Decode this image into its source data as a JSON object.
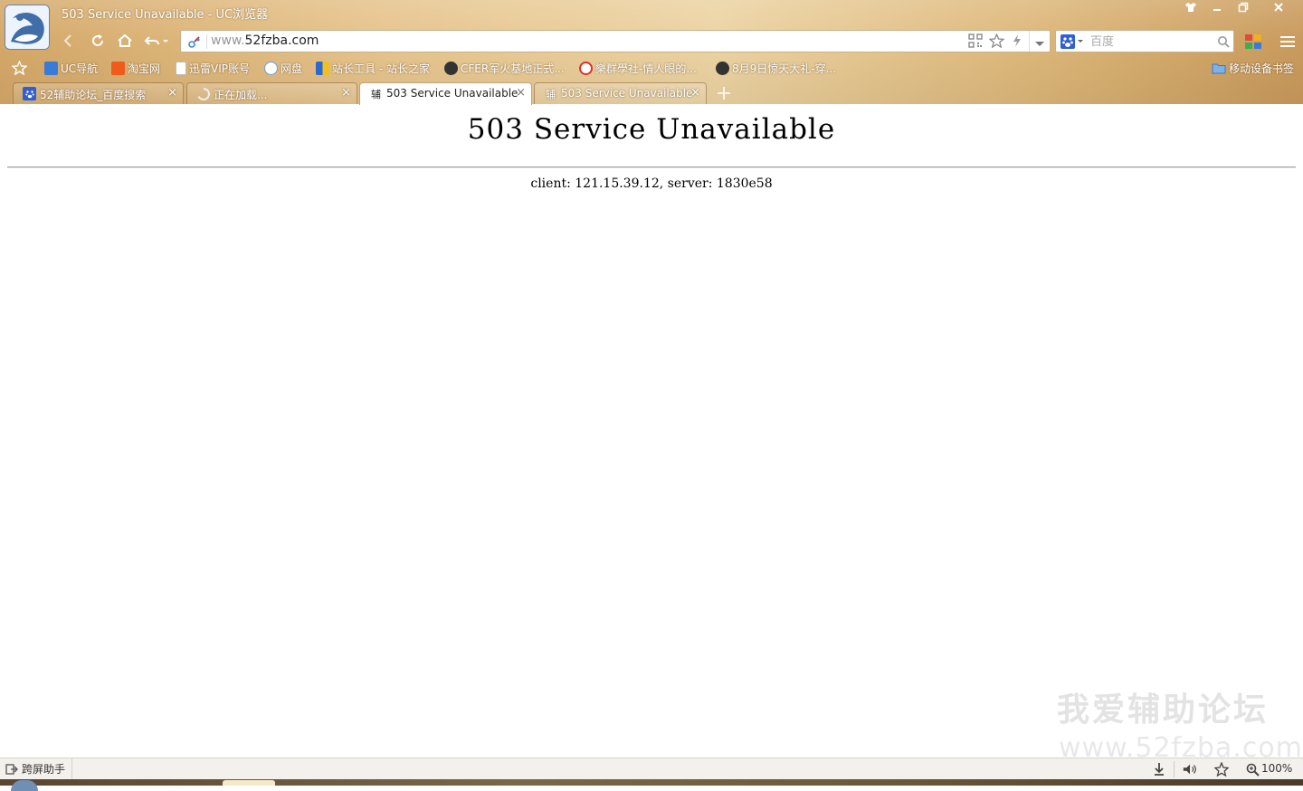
{
  "window": {
    "title": "503 Service Unavailable - UC浏览器"
  },
  "toolbar": {
    "address_prefix": "www.",
    "address_domain": "52fzba.com",
    "search_placeholder": "百度"
  },
  "bookmarks": {
    "items": [
      {
        "label": "UC导航"
      },
      {
        "label": "淘宝网"
      },
      {
        "label": "迅雷VIP账号"
      },
      {
        "label": "网盘"
      },
      {
        "label": "站长工具 - 站长之家"
      },
      {
        "label": "CFER军火基地正式..."
      },
      {
        "label": "樂群學社-情人眼的..."
      },
      {
        "label": "8月9日惊天大礼-穿..."
      }
    ],
    "mobile_folder": "移动设备书签"
  },
  "tabs": [
    {
      "label": "52辅助论坛_百度搜索",
      "icon": "辅"
    },
    {
      "label": "正在加载...",
      "icon": ""
    },
    {
      "label": "503 Service Unavailable",
      "icon": "辅",
      "active": true
    },
    {
      "label": "503 Service Unavailable",
      "icon": "辅"
    }
  ],
  "content": {
    "heading": "503 Service Unavailable",
    "detail": "client: 121.15.39.12, server: 1830e58",
    "watermark_cn": "我爱辅助论坛",
    "watermark_url": "www.52fzba.com"
  },
  "statusbar": {
    "helper_label": "跨屏助手",
    "zoom": "100%"
  }
}
